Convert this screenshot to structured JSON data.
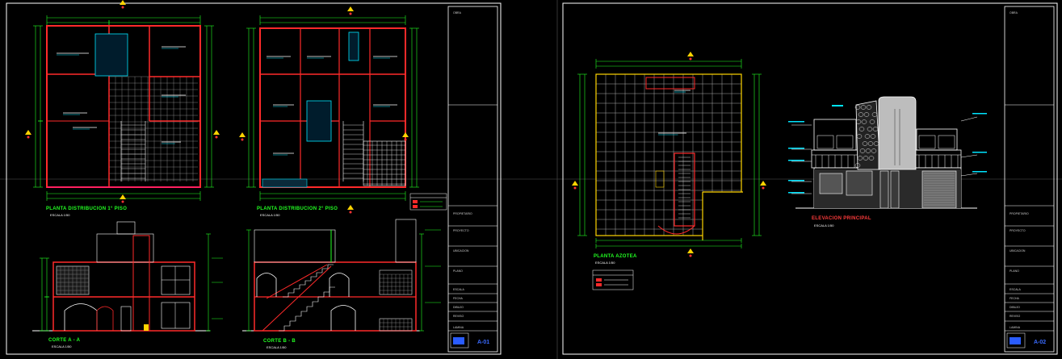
{
  "sheet1": {
    "drawings": {
      "plan1": {
        "title": "PLANTA DISTRIBUCION 1° PISO",
        "scale": "ESCALA 1/50"
      },
      "plan2": {
        "title": "PLANTA DISTRIBUCION 2° PISO",
        "scale": "ESCALA 1/50"
      },
      "section_a": {
        "title": "CORTE A - A",
        "scale": "ESCALA 1/50"
      },
      "section_b": {
        "title": "CORTE B - B",
        "scale": "ESCALA 1/50"
      }
    },
    "sheet_number": "A-01"
  },
  "sheet2": {
    "drawings": {
      "roof": {
        "title": "PLANTA AZOTEA",
        "scale": "ESCALA 1/50"
      },
      "elevation": {
        "title": "ELEVACION PRINCIPAL",
        "scale": "ESCALA 1/50"
      }
    },
    "sheet_number": "A-02"
  },
  "title_block": {
    "fields": [
      "OBRA",
      "PROPIETARIO",
      "PROYECTO",
      "UBICACION",
      "PLANO",
      "ESCALA",
      "FECHA",
      "DIBUJO",
      "REVISO",
      "LAMINA"
    ]
  },
  "colors": {
    "background": "#000000",
    "wall": "#ff2a2a",
    "dimension": "#22ff22",
    "frame": "#ffffff",
    "label": "#00e5ff",
    "marker": "#ffd400",
    "accent": "#ff00ff"
  }
}
